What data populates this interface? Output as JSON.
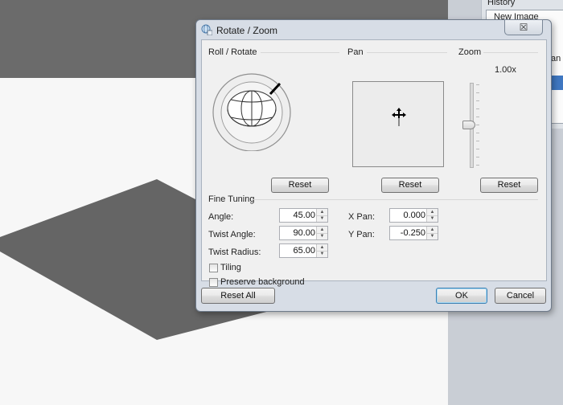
{
  "background": {
    "history_panel": {
      "title": "History",
      "item_label": "New Image",
      "cut_text": "tan"
    }
  },
  "dialog": {
    "title": "Rotate / Zoom",
    "close_glyph": "☒",
    "sections": {
      "roll_rotate": "Roll / Rotate",
      "pan": "Pan",
      "zoom": "Zoom",
      "fine_tuning": "Fine Tuning"
    },
    "zoom_value": "1.00x",
    "zoom_level_fraction": 0.5,
    "reset_buttons": [
      "Reset",
      "Reset",
      "Reset"
    ],
    "fields": {
      "angle": {
        "label": "Angle:",
        "value": "45.00"
      },
      "twist_angle": {
        "label": "Twist Angle:",
        "value": "90.00"
      },
      "twist_radius": {
        "label": "Twist Radius:",
        "value": "65.00"
      },
      "x_pan": {
        "label": "X Pan:",
        "value": "0.000"
      },
      "y_pan": {
        "label": "Y Pan:",
        "value": "-0.250"
      }
    },
    "checkboxes": {
      "tiling": {
        "label": "Tiling",
        "checked": false
      },
      "preserve_background": {
        "label": "Preserve background",
        "checked": false
      }
    },
    "buttons": {
      "reset_all": "Reset All",
      "ok": "OK",
      "cancel": "Cancel"
    },
    "icons": {
      "title": "rotate-zoom-icon",
      "pan": "move-cross-icon",
      "spin_up": "▲",
      "spin_down": "▼"
    },
    "colors": {
      "dialog_frame": "#d7dde6",
      "client": "#f0f0f0",
      "default_button_border": "#3c7fb1"
    }
  }
}
